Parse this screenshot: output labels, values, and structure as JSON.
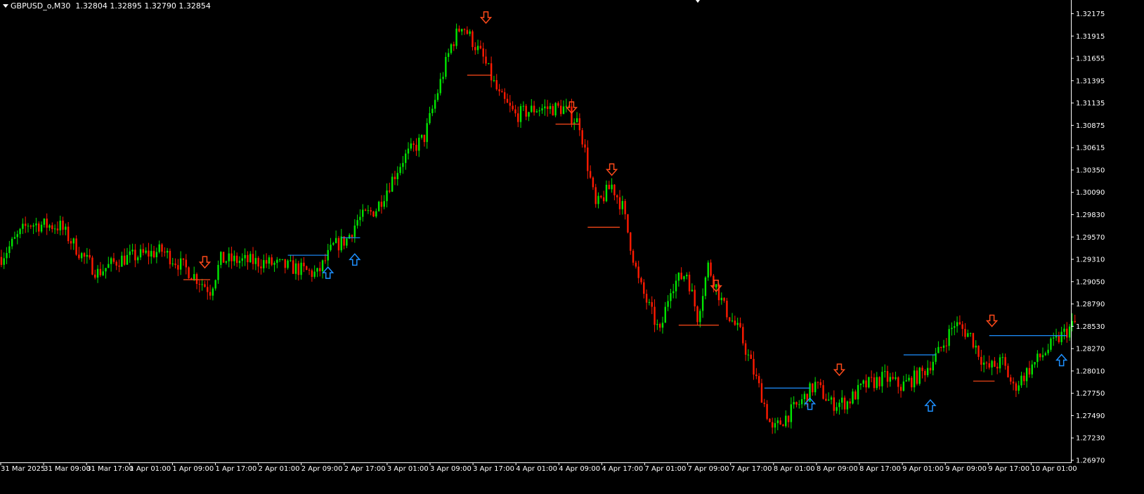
{
  "header": {
    "symbol_period": "GBPUSD_o,M30",
    "ohlc": "1.32804 1.32895 1.32790 1.32854"
  },
  "colors": {
    "background": "#000000",
    "bull": "#00e600",
    "bear": "#ff1a00",
    "axis": "#ffffff",
    "down_arrow": "#ff4a1a",
    "up_arrow": "#1e90ff",
    "level_sell": "#ff4a1a",
    "level_buy": "#1e90ff"
  },
  "chart_data": {
    "type": "candlestick",
    "title": "GBPUSD_o,M30",
    "grid": false,
    "ylim": [
      1.2693,
      1.3222
    ],
    "y_ticks": [
      "1.32175",
      "1.31915",
      "1.31655",
      "1.31395",
      "1.31135",
      "1.30875",
      "1.30615",
      "1.30350",
      "1.30090",
      "1.29830",
      "1.29570",
      "1.29310",
      "1.29050",
      "1.28790",
      "1.28530",
      "1.28270",
      "1.28010",
      "1.27750",
      "1.27490",
      "1.27230",
      "1.26970"
    ],
    "x_ticks": [
      "31 Mar 2025",
      "31 Mar 09:00",
      "31 Mar 17:00",
      "1 Apr 01:00",
      "1 Apr 09:00",
      "1 Apr 17:00",
      "2 Apr 01:00",
      "2 Apr 09:00",
      "2 Apr 17:00",
      "3 Apr 01:00",
      "3 Apr 09:00",
      "3 Apr 17:00",
      "4 Apr 01:00",
      "4 Apr 09:00",
      "4 Apr 17:00",
      "7 Apr 01:00",
      "7 Apr 09:00",
      "7 Apr 17:00",
      "8 Apr 01:00",
      "8 Apr 09:00",
      "8 Apr 17:00",
      "9 Apr 01:00",
      "9 Apr 09:00",
      "9 Apr 17:00",
      "10 Apr 01:00"
    ],
    "bars_per_tick": 16,
    "price_path": [
      {
        "bar": 0,
        "price": 1.2928
      },
      {
        "bar": 10,
        "price": 1.2966
      },
      {
        "bar": 22,
        "price": 1.2963
      },
      {
        "bar": 30,
        "price": 1.293
      },
      {
        "bar": 36,
        "price": 1.291
      },
      {
        "bar": 44,
        "price": 1.2925
      },
      {
        "bar": 60,
        "price": 1.2935
      },
      {
        "bar": 70,
        "price": 1.2912
      },
      {
        "bar": 78,
        "price": 1.289
      },
      {
        "bar": 82,
        "price": 1.2925
      },
      {
        "bar": 98,
        "price": 1.2922
      },
      {
        "bar": 110,
        "price": 1.2915
      },
      {
        "bar": 118,
        "price": 1.2908
      },
      {
        "bar": 124,
        "price": 1.294
      },
      {
        "bar": 129,
        "price": 1.2948
      },
      {
        "bar": 133,
        "price": 1.297
      },
      {
        "bar": 140,
        "price": 1.2983
      },
      {
        "bar": 150,
        "price": 1.304
      },
      {
        "bar": 158,
        "price": 1.3065
      },
      {
        "bar": 168,
        "price": 1.317
      },
      {
        "bar": 172,
        "price": 1.3195
      },
      {
        "bar": 180,
        "price": 1.3155
      },
      {
        "bar": 186,
        "price": 1.3112
      },
      {
        "bar": 192,
        "price": 1.309
      },
      {
        "bar": 200,
        "price": 1.3098
      },
      {
        "bar": 210,
        "price": 1.3098
      },
      {
        "bar": 216,
        "price": 1.308
      },
      {
        "bar": 222,
        "price": 1.2985
      },
      {
        "bar": 228,
        "price": 1.301
      },
      {
        "bar": 232,
        "price": 1.2985
      },
      {
        "bar": 238,
        "price": 1.29
      },
      {
        "bar": 246,
        "price": 1.284
      },
      {
        "bar": 250,
        "price": 1.2895
      },
      {
        "bar": 256,
        "price": 1.291
      },
      {
        "bar": 260,
        "price": 1.286
      },
      {
        "bar": 264,
        "price": 1.2918
      },
      {
        "bar": 270,
        "price": 1.287
      },
      {
        "bar": 276,
        "price": 1.284
      },
      {
        "bar": 284,
        "price": 1.277
      },
      {
        "bar": 288,
        "price": 1.2728
      },
      {
        "bar": 292,
        "price": 1.2742
      },
      {
        "bar": 298,
        "price": 1.276
      },
      {
        "bar": 304,
        "price": 1.2782
      },
      {
        "bar": 310,
        "price": 1.276
      },
      {
        "bar": 316,
        "price": 1.2762
      },
      {
        "bar": 322,
        "price": 1.278
      },
      {
        "bar": 330,
        "price": 1.279
      },
      {
        "bar": 336,
        "price": 1.278
      },
      {
        "bar": 344,
        "price": 1.2795
      },
      {
        "bar": 350,
        "price": 1.2818
      },
      {
        "bar": 356,
        "price": 1.2852
      },
      {
        "bar": 362,
        "price": 1.2838
      },
      {
        "bar": 368,
        "price": 1.28
      },
      {
        "bar": 374,
        "price": 1.2808
      },
      {
        "bar": 378,
        "price": 1.2778
      },
      {
        "bar": 384,
        "price": 1.28
      },
      {
        "bar": 390,
        "price": 1.282
      },
      {
        "bar": 396,
        "price": 1.2838
      },
      {
        "bar": 401,
        "price": 1.2852
      }
    ],
    "down_arrows": [
      {
        "bar": 76,
        "price": 1.2922
      },
      {
        "bar": 181,
        "price": 1.3202
      },
      {
        "bar": 213,
        "price": 1.3099
      },
      {
        "bar": 228,
        "price": 1.3028
      },
      {
        "bar": 267,
        "price": 1.2895
      },
      {
        "bar": 313,
        "price": 1.2799
      },
      {
        "bar": 370,
        "price": 1.2855
      }
    ],
    "up_arrows": [
      {
        "bar": 122,
        "price": 1.291
      },
      {
        "bar": 132,
        "price": 1.2925
      },
      {
        "bar": 302,
        "price": 1.276
      },
      {
        "bar": 347,
        "price": 1.2758
      },
      {
        "bar": 396,
        "price": 1.281
      }
    ],
    "levels": [
      {
        "kind": "sell",
        "bar_start": 68,
        "bar_end": 78,
        "price": 1.2902
      },
      {
        "kind": "buy",
        "bar_start": 107,
        "bar_end": 122,
        "price": 1.293
      },
      {
        "kind": "buy",
        "bar_start": 127,
        "bar_end": 134,
        "price": 1.295
      },
      {
        "kind": "sell",
        "bar_start": 174,
        "bar_end": 183,
        "price": 1.3136
      },
      {
        "kind": "sell",
        "bar_start": 207,
        "bar_end": 216,
        "price": 1.308
      },
      {
        "kind": "sell",
        "bar_start": 219,
        "bar_end": 231,
        "price": 1.2962
      },
      {
        "kind": "sell",
        "bar_start": 253,
        "bar_end": 268,
        "price": 1.285
      },
      {
        "kind": "buy",
        "bar_start": 285,
        "bar_end": 302,
        "price": 1.2778
      },
      {
        "kind": "buy",
        "bar_start": 337,
        "bar_end": 349,
        "price": 1.2816
      },
      {
        "kind": "sell",
        "bar_start": 363,
        "bar_end": 371,
        "price": 1.2786
      },
      {
        "kind": "buy",
        "bar_start": 369,
        "bar_end": 398,
        "price": 1.2838
      }
    ]
  }
}
